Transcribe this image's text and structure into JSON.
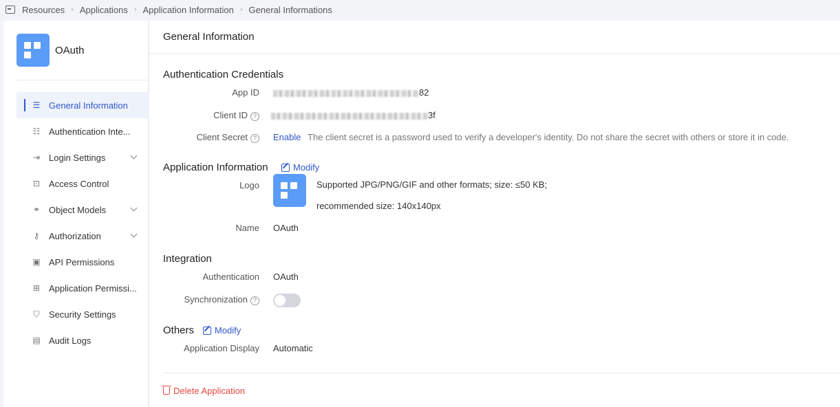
{
  "breadcrumb": [
    "Resources",
    "Applications",
    "Application Information",
    "General Informations"
  ],
  "app": {
    "name": "OAuth"
  },
  "sidebar": {
    "items": [
      {
        "label": "General Information",
        "icon": "list-icon"
      },
      {
        "label": "Authentication Inte...",
        "icon": "sliders-icon"
      },
      {
        "label": "Login Settings",
        "icon": "login-icon"
      },
      {
        "label": "Access Control",
        "icon": "access-icon"
      },
      {
        "label": "Object Models",
        "icon": "model-icon"
      },
      {
        "label": "Authorization",
        "icon": "key-icon"
      },
      {
        "label": "API Permissions",
        "icon": "chip-icon"
      },
      {
        "label": "Application Permissi...",
        "icon": "grid-icon"
      },
      {
        "label": "Security Settings",
        "icon": "shield-icon"
      },
      {
        "label": "Audit Logs",
        "icon": "doc-icon"
      }
    ]
  },
  "main": {
    "title": "General Information",
    "credentials": {
      "title": "Authentication Credentials",
      "app_id_label": "App ID",
      "app_id_suffix": "82",
      "client_id_label": "Client ID",
      "client_id_suffix": "3f",
      "client_secret_label": "Client Secret",
      "enable_label": "Enable",
      "secret_hint": "The client secret is a password used to verify a developer's identity. Do not share the secret with others or store it in code."
    },
    "app_info": {
      "title": "Application Information",
      "modify_label": "Modify",
      "logo_label": "Logo",
      "logo_hint_1": "Supported JPG/PNG/GIF and other formats; size: ≤50 KB;",
      "logo_hint_2": "recommended size: 140x140px",
      "name_label": "Name",
      "name_value": "OAuth"
    },
    "integration": {
      "title": "Integration",
      "auth_label": "Authentication",
      "auth_value": "OAuth",
      "sync_label": "Synchronization"
    },
    "others": {
      "title": "Others",
      "modify_label": "Modify",
      "display_label": "Application Display",
      "display_value": "Automatic"
    },
    "delete_label": "Delete Application"
  },
  "colors": {
    "accent": "#2f57c9",
    "logo_bg": "#5a9cf8",
    "danger": "#e5483d"
  }
}
